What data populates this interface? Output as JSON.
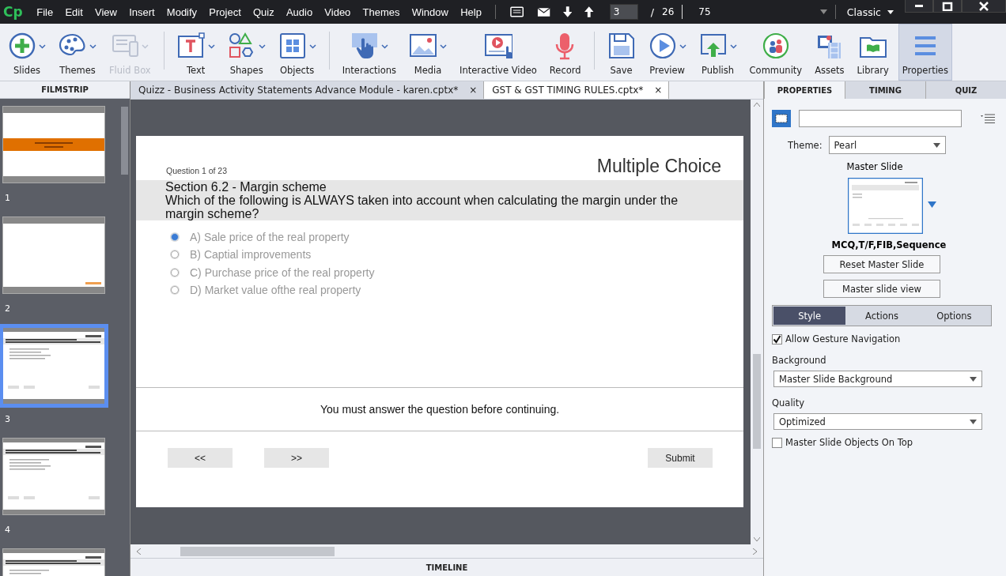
{
  "menu_bar": {
    "logo": "Cp",
    "items": [
      "File",
      "Edit",
      "View",
      "Insert",
      "Modify",
      "Project",
      "Quiz",
      "Audio",
      "Video",
      "Themes",
      "Window",
      "Help"
    ],
    "slide_current": "3",
    "slide_separator": "/",
    "slide_total": "26",
    "zoom": "75",
    "workspace": "Classic"
  },
  "toolbar": {
    "groups": [
      [
        {
          "kind": "slides",
          "label": "Slides",
          "disabled": false,
          "has_menu": true,
          "selected": false
        },
        {
          "kind": "themes",
          "label": "Themes",
          "disabled": false,
          "has_menu": true,
          "selected": false
        },
        {
          "kind": "fluid",
          "label": "Fluid Box",
          "disabled": true,
          "has_menu": true,
          "selected": false
        }
      ],
      [
        {
          "kind": "text",
          "label": "Text",
          "disabled": false,
          "has_menu": true,
          "selected": false
        },
        {
          "kind": "shapes",
          "label": "Shapes",
          "disabled": false,
          "has_menu": true,
          "selected": false
        },
        {
          "kind": "objects",
          "label": "Objects",
          "disabled": false,
          "has_menu": true,
          "selected": false
        }
      ],
      [
        {
          "kind": "interactions",
          "label": "Interactions",
          "disabled": false,
          "has_menu": true,
          "selected": false
        },
        {
          "kind": "media",
          "label": "Media",
          "disabled": false,
          "has_menu": true,
          "selected": false
        },
        {
          "kind": "video",
          "label": "Interactive Video",
          "disabled": false,
          "has_menu": false,
          "selected": false
        },
        {
          "kind": "record",
          "label": "Record",
          "disabled": false,
          "has_menu": false,
          "selected": false
        }
      ],
      [
        {
          "kind": "save",
          "label": "Save",
          "disabled": false,
          "has_menu": false,
          "selected": false
        },
        {
          "kind": "preview",
          "label": "Preview",
          "disabled": false,
          "has_menu": true,
          "selected": false
        },
        {
          "kind": "publish",
          "label": "Publish",
          "disabled": false,
          "has_menu": true,
          "selected": false
        },
        {
          "kind": "community",
          "label": "Community",
          "disabled": false,
          "has_menu": false,
          "selected": false
        },
        {
          "kind": "assets",
          "label": "Assets",
          "disabled": false,
          "has_menu": false,
          "selected": false
        },
        {
          "kind": "library",
          "label": "Library",
          "disabled": false,
          "has_menu": false,
          "selected": false
        },
        {
          "kind": "properties",
          "label": "Properties",
          "disabled": false,
          "has_menu": false,
          "selected": true
        }
      ]
    ]
  },
  "filmstrip": {
    "title": "FILMSTRIP",
    "slides": [
      {
        "number": "1",
        "kind": "title",
        "selected": false
      },
      {
        "number": "2",
        "kind": "blank",
        "selected": false
      },
      {
        "number": "3",
        "kind": "quiz",
        "selected": true
      },
      {
        "number": "4",
        "kind": "quiz",
        "selected": false
      },
      {
        "kind": "quiz",
        "selected": false
      }
    ]
  },
  "document_tabs": [
    {
      "label": "Quizz - Business Activity Statements Advance Module - karen.cptx*",
      "close": "×",
      "selected": false
    },
    {
      "label": "GST & GST TIMING RULES.cptx*",
      "close": "×",
      "selected": true
    }
  ],
  "slide": {
    "question_number": "Question 1 of 23",
    "title": "Multiple Choice",
    "heading": "Section 6.2 - Margin scheme",
    "question": "Which of the following is ALWAYS taken into account when calculating the margin under the margin scheme?",
    "options": [
      {
        "label": "A) Sale price of the real property",
        "selected": true
      },
      {
        "label": "B) Captial improvements",
        "selected": false
      },
      {
        "label": "C) Purchase price of the real property",
        "selected": false
      },
      {
        "label": "D) Market value ofthe real property",
        "selected": false
      }
    ],
    "message": "You must answer the question before continuing.",
    "buttons": [
      "<<",
      ">>",
      "Submit"
    ]
  },
  "timeline": {
    "title": "TIMELINE"
  },
  "panel": {
    "tabs": [
      {
        "label": "PROPERTIES",
        "selected": true
      },
      {
        "label": "TIMING",
        "selected": false
      },
      {
        "label": "QUIZ",
        "selected": false
      }
    ],
    "theme_label": "Theme:",
    "theme": "Pearl",
    "master_slide_label": "Master Slide",
    "master_slide_name": "MCQ,T/F,FIB,Sequence",
    "buttons": [
      "Reset Master Slide",
      "Master slide view"
    ],
    "subtabs": [
      {
        "label": "Style",
        "selected": true
      },
      {
        "label": "Actions",
        "selected": false
      },
      {
        "label": "Options",
        "selected": false
      }
    ],
    "allow_gesture": {
      "label": "Allow Gesture Navigation",
      "checked": true
    },
    "background_label": "Background",
    "background": "Master Slide Background",
    "quality_label": "Quality",
    "quality": "Optimized",
    "objects_on_top": {
      "label": "Master Slide Objects On Top",
      "checked": false
    }
  }
}
